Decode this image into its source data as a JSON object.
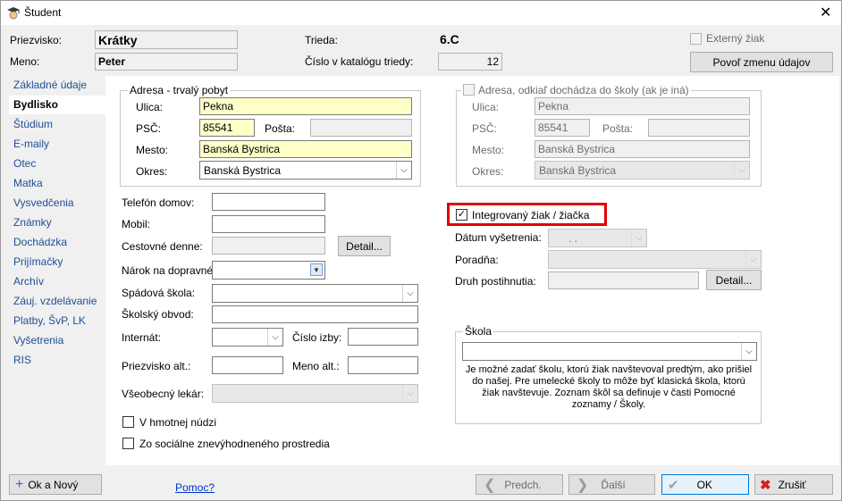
{
  "window": {
    "title": "Študent",
    "close_glyph": "✕"
  },
  "header": {
    "priezvisko_label": "Priezvisko:",
    "priezvisko_value": "Krátky",
    "meno_label": "Meno:",
    "meno_value": "Peter",
    "trieda_label": "Trieda:",
    "trieda_value": "6.C",
    "katalog_label": "Číslo v katalógu triedy:",
    "katalog_value": "12",
    "externy_label": "Externý žiak",
    "povol_button": "Povoľ zmenu údajov"
  },
  "sidebar": {
    "items": [
      {
        "label": "Základné údaje"
      },
      {
        "label": "Bydlisko"
      },
      {
        "label": "Štúdium"
      },
      {
        "label": "E-maily"
      },
      {
        "label": "Otec"
      },
      {
        "label": "Matka"
      },
      {
        "label": "Vysvedčenia"
      },
      {
        "label": "Známky"
      },
      {
        "label": "Dochádzka"
      },
      {
        "label": "Prijímačky"
      },
      {
        "label": "Archív"
      },
      {
        "label": "Záuj. vzdelávanie"
      },
      {
        "label": "Platby, ŠvP, LK"
      },
      {
        "label": "Vyšetrenia"
      },
      {
        "label": "RIS"
      }
    ],
    "active_index": 1
  },
  "adresa_trvala": {
    "caption": "Adresa - trvalý pobyt",
    "ulica_label": "Ulica:",
    "ulica_value": "Pekna",
    "psc_label": "PSČ:",
    "psc_value": "85541",
    "posta_label": "Pošta:",
    "posta_value": "",
    "mesto_label": "Mesto:",
    "mesto_value": "Banská Bystrica",
    "okres_label": "Okres:",
    "okres_value": "Banská Bystrica"
  },
  "adresa_skola": {
    "caption": "Adresa, odkiaľ dochádza do školy (ak je iná)",
    "ulica_label": "Ulica:",
    "ulica_value": "Pekna",
    "psc_label": "PSČ:",
    "psc_value": "85541",
    "posta_label": "Pošta:",
    "mesto_label": "Mesto:",
    "mesto_value": "Banská Bystrica",
    "okres_label": "Okres:",
    "okres_value": "Banská Bystrica"
  },
  "kontakty": {
    "telefon_label": "Telefón domov:",
    "mobil_label": "Mobil:",
    "cestovne_label": "Cestovné denne:",
    "detail_button": "Detail...",
    "narok_label": "Nárok na dopravné:",
    "spadova_label": "Spádová škola:",
    "obvod_label": "Školský obvod:",
    "internat_label": "Internát:",
    "cislo_izby_label": "Číslo izby:",
    "priezvisko_alt_label": "Priezvisko alt.:",
    "meno_alt_label": "Meno alt.:",
    "lekar_label": "Všeobecný lekár:",
    "hmotna_nudza_label": "V hmotnej núdzi",
    "znevyhodnene_label": "Zo sociálne znevýhodneného prostredia"
  },
  "integrovany": {
    "label": "Integrovaný žiak / žiačka",
    "checked_glyph": "✓",
    "datum_label": "Dátum vyšetrenia:",
    "datum_value": ". .",
    "poradna_label": "Poradňa:",
    "druh_label": "Druh postihnutia:",
    "detail_button": "Detail..."
  },
  "skola_group": {
    "caption": "Škola",
    "note": "Je možné zadať školu, ktorú žiak navštevoval predtým, ako prišiel do našej. Pre umelecké školy to môže byť klasická škola, ktorú žiak navštevuje. Zoznam škôl sa definuje v časti Pomocné zoznamy / Školy."
  },
  "footer": {
    "ok_novy": "Ok a Nový",
    "pomoc": "Pomoc?",
    "predch": "Predch.",
    "dalsi": "Ďalší",
    "ok": "OK",
    "zrusit": "Zrušiť"
  },
  "colors": {
    "accent": "#0078d7",
    "highlight_red": "#e00000",
    "required_yellow": "#ffffc8",
    "sidebar_link": "#1f4e95"
  },
  "icons": [
    "student-app-icon",
    "close-icon",
    "plus-icon",
    "chevron-left-icon",
    "chevron-right-icon",
    "checkmark-icon",
    "cancel-x-icon",
    "chevron-down-icon"
  ]
}
